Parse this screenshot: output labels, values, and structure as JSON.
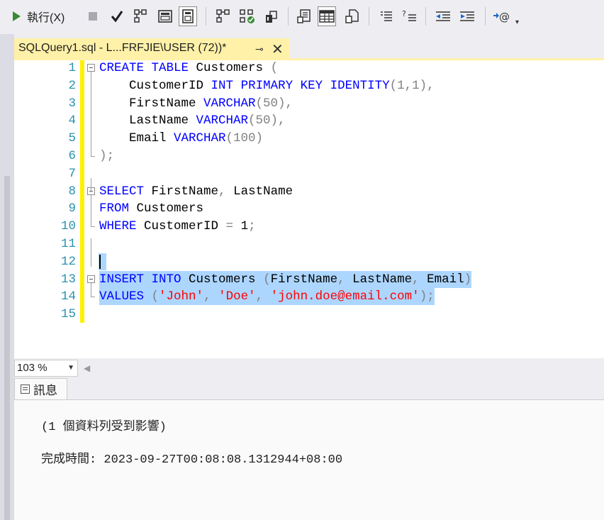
{
  "toolbar": {
    "execute_label": "執行(X)",
    "icons": [
      "stop-icon",
      "parse-checkmark-icon",
      "display-estimated-plan-icon",
      "query-options-icon",
      "intellisense-icon",
      "include-actual-plan-icon",
      "live-query-stats-icon",
      "client-statistics-icon",
      "results-to-text-icon",
      "results-to-grid-icon",
      "results-to-file-icon",
      "comment-out-icon",
      "uncomment-icon",
      "decrease-indent-icon",
      "increase-indent-icon",
      "specify-template-values-icon",
      "toolbar-options-icon"
    ]
  },
  "tab": {
    "title": "SQLQuery1.sql - L...FRFJIE\\USER (72))*"
  },
  "editor": {
    "line_numbers": [
      "1",
      "2",
      "3",
      "4",
      "5",
      "6",
      "7",
      "8",
      "9",
      "10",
      "11",
      "12",
      "13",
      "14",
      "15"
    ],
    "lines": [
      [
        "CREATE",
        " ",
        "TABLE",
        " Customers ",
        "("
      ],
      [
        "    CustomerID ",
        "INT",
        " ",
        "PRIMARY",
        " ",
        "KEY",
        " ",
        "IDENTITY",
        "(1,1),"
      ],
      [
        "    FirstName ",
        "VARCHAR",
        "(50),"
      ],
      [
        "    LastName ",
        "VARCHAR",
        "(50),"
      ],
      [
        "    Email ",
        "VARCHAR",
        "(100)"
      ],
      [
        ");"
      ],
      [],
      [
        "SELECT",
        " FirstName",
        ",",
        " LastName"
      ],
      [
        "FROM",
        " Customers"
      ],
      [
        "WHERE",
        " CustomerID ",
        "=",
        " 1",
        ";"
      ],
      [],
      [],
      [
        "INSERT",
        " ",
        "INTO",
        " Customers ",
        "(",
        "FirstName",
        ",",
        " LastName",
        ",",
        " Email",
        ")"
      ],
      [
        "VALUES",
        " ",
        "(",
        "'John'",
        ",",
        " ",
        "'Doe'",
        ",",
        " ",
        "'john.doe@email.com'",
        ");"
      ],
      []
    ]
  },
  "zoom": {
    "value": "103 %"
  },
  "results": {
    "tab_label": "訊息",
    "messages": [
      "(1 個資料列受到影響)",
      "完成時間: 2023-09-27T00:08:08.1312944+08:00"
    ]
  },
  "colors": {
    "keyword": "#0000ff",
    "operator": "#808080",
    "string": "#ff0000",
    "line_number": "#2b91af",
    "selection": "#add6ff",
    "tab_active": "#fff1a8",
    "change_margin": "#fff000"
  }
}
